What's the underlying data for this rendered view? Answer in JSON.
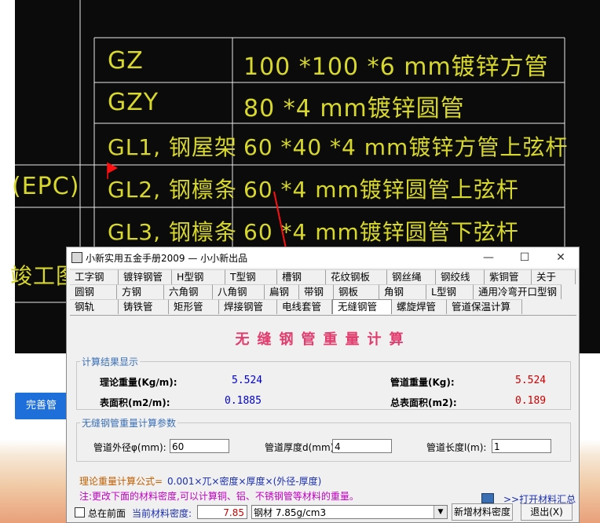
{
  "cad": {
    "rows": [
      {
        "code": "GZ",
        "spec": "100 *100 *6 mm镀锌方管"
      },
      {
        "code": "GZY",
        "spec": "80 *4 mm镀锌圆管"
      },
      {
        "code": "GL1, 钢屋架",
        "spec": "60 *40 *4 mm镀锌方管上弦杆"
      },
      {
        "code": "GL2, 钢檩条",
        "spec": "60 *4 mm镀锌圆管上弦杆"
      },
      {
        "code": "GL3, 钢檩条",
        "spec": "60 *4 mm镀锌圆管下弦杆"
      }
    ],
    "left_fragment_1": "(EPC)",
    "left_fragment_2": "竣工图",
    "color": "#d8d82a"
  },
  "page": {
    "blue_button_label": "完善管"
  },
  "window": {
    "title": "小新实用五金手册2009 — 小小新出品",
    "controls": {
      "minimize": "—",
      "maximize": "☐",
      "close": "✕"
    },
    "tabs_row1": [
      "工字钢",
      "镀锌钢管",
      "H型钢",
      "T型钢",
      "槽钢",
      "花纹钢板",
      "钢丝绳",
      "钢绞线",
      "紫铜管",
      "关于"
    ],
    "tabs_row2": [
      "圆钢",
      "方钢",
      "六角钢",
      "八角钢",
      "扁钢",
      "带钢",
      "钢板",
      "角钢",
      "L型钢",
      "通用冷弯开口型钢"
    ],
    "tabs_row3": [
      "钢轨",
      "铸铁管",
      "矩形管",
      "焊接钢管",
      "电线套管",
      "无缝钢管",
      "螺旋焊管",
      "管道保温计算"
    ],
    "active_tab": "无缝钢管",
    "heading": "无缝钢管重量计算",
    "results": {
      "legend": "计算结果显示",
      "theory_weight_label": "理论重量(Kg/m):",
      "theory_weight_value": "5.524",
      "pipe_weight_label": "管道重量(Kg):",
      "pipe_weight_value": "5.524",
      "surface_label": "表面积(m2/m):",
      "surface_value": "0.1885",
      "total_surface_label": "总表面积(m2):",
      "total_surface_value": "0.189"
    },
    "params": {
      "legend": "无缝钢管重量计算参数",
      "od_label": "管道外径φ(mm):",
      "od_value": "60",
      "thickness_label": "管道厚度d(mm):",
      "thickness_value": "4",
      "length_label": "管道长度l(m):",
      "length_value": "1"
    },
    "formula_label": "理论重量计算公式=",
    "formula": "0.001×兀×密度×厚度×(外径-厚度)",
    "note": "注:更改下面的材料密度,可以计算铜、铝、不锈钢管等材料的重量。",
    "open_summary": ">>打开材料汇总",
    "always_on_top": "总在前面",
    "density_label": "当前材料密度:",
    "density_value": "7.85",
    "material_select": "钢材 7.85g/cm3",
    "add_density_button": "新增材料密度",
    "exit_button": "退出(X)",
    "colors": {
      "blue_value": "#0000cc",
      "red_value": "#cc0000",
      "heading": "#e23c6e",
      "legend": "#3a6fb4",
      "formula": "#c06000",
      "note": "#c000c0"
    }
  }
}
